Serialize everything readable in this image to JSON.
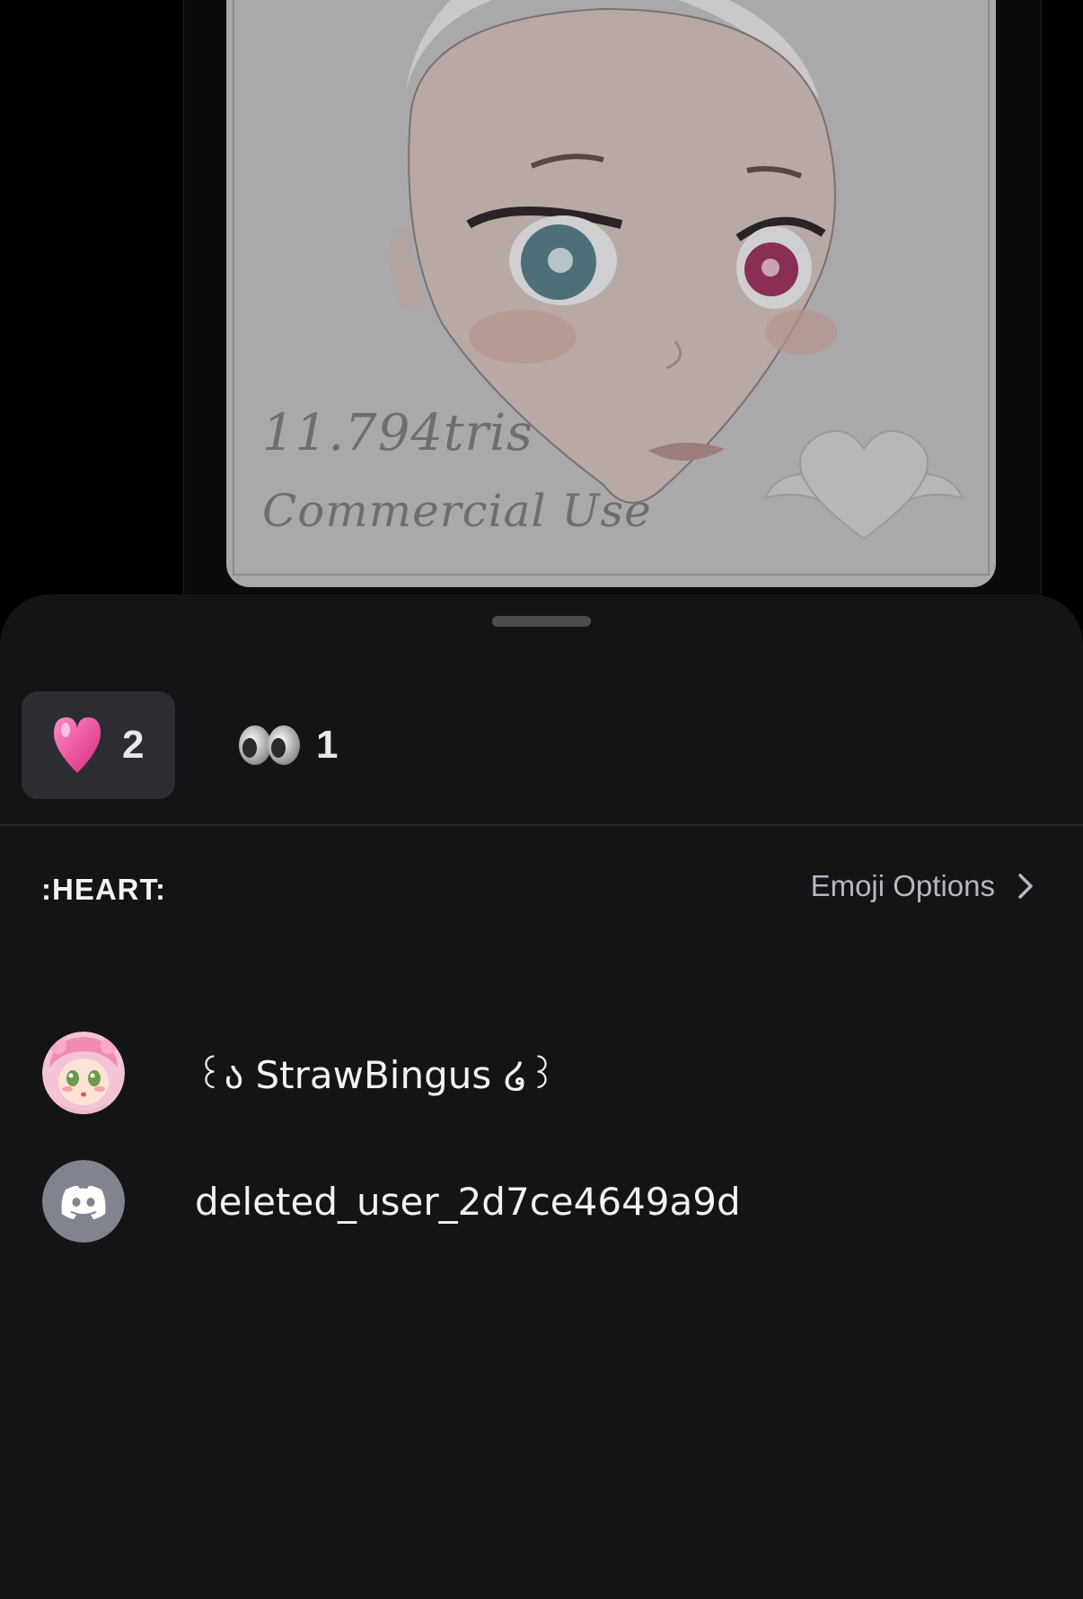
{
  "preview": {
    "watermark_tris": "11.794tris",
    "watermark_use": "Commercial Use"
  },
  "reactions": [
    {
      "emoji": "heart-emoji",
      "count": "2",
      "selected": true
    },
    {
      "emoji": "eyes-emoji",
      "count": "1",
      "selected": false
    }
  ],
  "emoji_header": {
    "name": ":HEART:",
    "options_label": "Emoji Options"
  },
  "users": [
    {
      "name": "꒰ა StrawBingus ໒꒱",
      "avatar": "anime-girl-avatar"
    },
    {
      "name": "deleted_user_2d7ce4649a9d",
      "avatar": "discord-default-avatar"
    }
  ],
  "colors": {
    "sheet_bg": "#131416",
    "selected_reaction_bg": "#2b2d33",
    "heart": "#e8479a",
    "discord_default_avatar": "#80848e"
  }
}
